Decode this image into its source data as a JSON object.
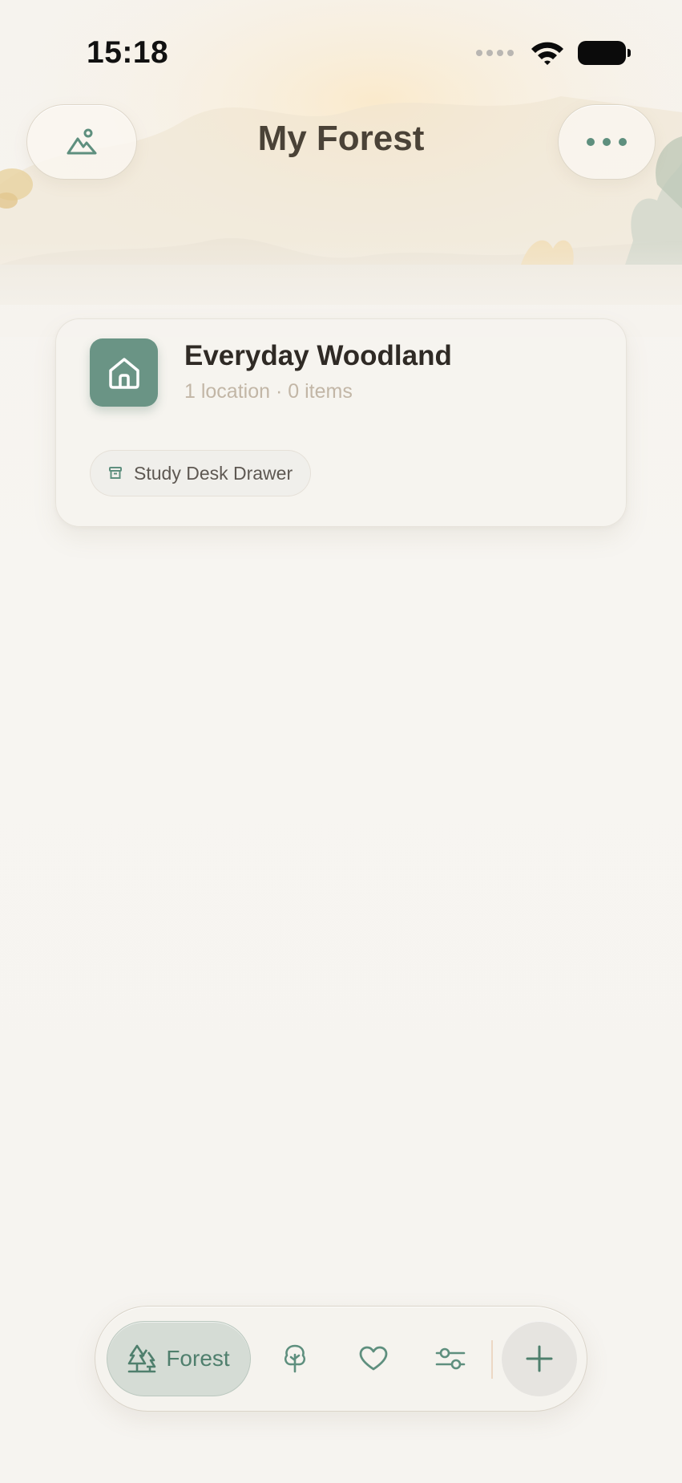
{
  "status_bar": {
    "time": "15:18",
    "icons": [
      "cellular-signal-icon",
      "wifi-icon",
      "battery-icon"
    ]
  },
  "header": {
    "title": "My Forest",
    "left_button_icon": "landscape-icon",
    "right_button_icon": "more-options-icon"
  },
  "forest_card": {
    "icon": "home-icon",
    "title": "Everyday Woodland",
    "meta": "1 location · 0 items",
    "locations": [
      {
        "icon": "archive-box-icon",
        "label": "Study Desk Drawer"
      }
    ]
  },
  "tab_bar": {
    "active_tab": {
      "icon": "trees-icon",
      "label": "Forest"
    },
    "tabs": [
      {
        "icon": "tree-icon"
      },
      {
        "icon": "heart-icon"
      },
      {
        "icon": "sliders-icon"
      }
    ],
    "add_icon": "plus-icon"
  },
  "colors": {
    "accent_green": "#6a9485",
    "accent_green_dark": "#4f7f6d",
    "title_brown": "#4a4237",
    "meta_tan": "#c2b6a6",
    "background": "#f6f4f0"
  }
}
